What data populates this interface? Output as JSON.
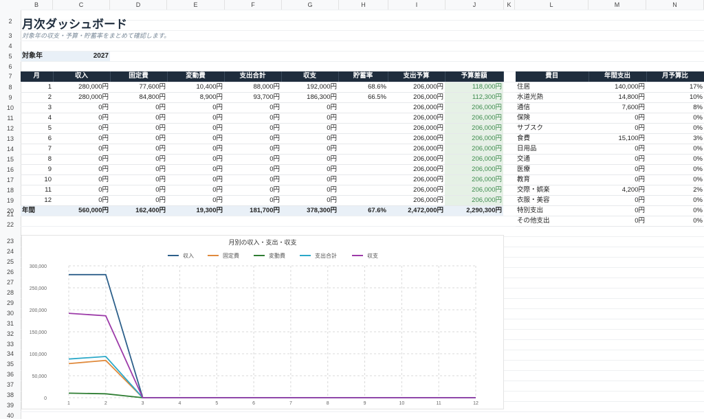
{
  "spreadsheet": {
    "columns": [
      "B",
      "C",
      "D",
      "E",
      "F",
      "G",
      "H",
      "I",
      "J",
      "K",
      "L",
      "M",
      "N"
    ],
    "rows": [
      "2",
      "3",
      "4",
      "5",
      "6",
      "7",
      "8",
      "9",
      "10",
      "11",
      "12",
      "13",
      "14",
      "15",
      "16",
      "17",
      "18",
      "19",
      "20",
      "21",
      "22",
      "23",
      "24",
      "25",
      "26",
      "27",
      "28",
      "29",
      "30",
      "31",
      "32",
      "33",
      "34",
      "35",
      "36",
      "37",
      "38",
      "39",
      "40"
    ]
  },
  "dashboard": {
    "title": "月次ダッシュボード",
    "subtitle": "対象年の収支・予算・貯蓄率をまとめて確認します。",
    "year_label": "対象年",
    "year_value": "2027"
  },
  "monthly_table": {
    "headers": [
      "月",
      "収入",
      "固定費",
      "変動費",
      "支出合計",
      "収支",
      "貯蓄率",
      "支出予算",
      "予算差額"
    ],
    "rows": [
      [
        "1",
        "280,000円",
        "77,600円",
        "10,400円",
        "88,000円",
        "192,000円",
        "68.6%",
        "206,000円",
        "118,000円"
      ],
      [
        "2",
        "280,000円",
        "84,800円",
        "8,900円",
        "93,700円",
        "186,300円",
        "66.5%",
        "206,000円",
        "112,300円"
      ],
      [
        "3",
        "0円",
        "0円",
        "0円",
        "0円",
        "0円",
        "",
        "206,000円",
        "206,000円"
      ],
      [
        "4",
        "0円",
        "0円",
        "0円",
        "0円",
        "0円",
        "",
        "206,000円",
        "206,000円"
      ],
      [
        "5",
        "0円",
        "0円",
        "0円",
        "0円",
        "0円",
        "",
        "206,000円",
        "206,000円"
      ],
      [
        "6",
        "0円",
        "0円",
        "0円",
        "0円",
        "0円",
        "",
        "206,000円",
        "206,000円"
      ],
      [
        "7",
        "0円",
        "0円",
        "0円",
        "0円",
        "0円",
        "",
        "206,000円",
        "206,000円"
      ],
      [
        "8",
        "0円",
        "0円",
        "0円",
        "0円",
        "0円",
        "",
        "206,000円",
        "206,000円"
      ],
      [
        "9",
        "0円",
        "0円",
        "0円",
        "0円",
        "0円",
        "",
        "206,000円",
        "206,000円"
      ],
      [
        "10",
        "0円",
        "0円",
        "0円",
        "0円",
        "0円",
        "",
        "206,000円",
        "206,000円"
      ],
      [
        "11",
        "0円",
        "0円",
        "0円",
        "0円",
        "0円",
        "",
        "206,000円",
        "206,000円"
      ],
      [
        "12",
        "0円",
        "0円",
        "0円",
        "0円",
        "0円",
        "",
        "206,000円",
        "206,000円"
      ]
    ],
    "total": [
      "年間",
      "560,000円",
      "162,400円",
      "19,300円",
      "181,700円",
      "378,300円",
      "67.6%",
      "2,472,000円",
      "2,290,300円"
    ]
  },
  "category_table": {
    "headers": [
      "費目",
      "年間支出",
      "月予算比"
    ],
    "rows": [
      [
        "住居",
        "140,000円",
        "17%"
      ],
      [
        "水道光熱",
        "14,800円",
        "10%"
      ],
      [
        "通信",
        "7,600円",
        "8%"
      ],
      [
        "保険",
        "0円",
        "0%"
      ],
      [
        "サブスク",
        "0円",
        "0%"
      ],
      [
        "食費",
        "15,100円",
        "3%"
      ],
      [
        "日用品",
        "0円",
        "0%"
      ],
      [
        "交通",
        "0円",
        "0%"
      ],
      [
        "医療",
        "0円",
        "0%"
      ],
      [
        "教育",
        "0円",
        "0%"
      ],
      [
        "交際・娯楽",
        "4,200円",
        "2%"
      ],
      [
        "衣服・美容",
        "0円",
        "0%"
      ],
      [
        "特別支出",
        "0円",
        "0%"
      ],
      [
        "その他支出",
        "0円",
        "0%"
      ]
    ]
  },
  "colors": {
    "header_bg": "#1f2d3d",
    "diff_bg": "#e6f1e6",
    "diff_text": "#3e8a4f",
    "total_bg": "#e9f0f7"
  },
  "chart_data": {
    "type": "line",
    "title": "月別の収入・支出・収支",
    "x": [
      1,
      2,
      3,
      4,
      5,
      6,
      7,
      8,
      9,
      10,
      11,
      12
    ],
    "ylim": [
      0,
      300000
    ],
    "yticks": [
      0,
      50000,
      100000,
      150000,
      200000,
      250000,
      300000
    ],
    "ytick_labels": [
      "0",
      "50,000",
      "100,000",
      "150,000",
      "200,000",
      "250,000",
      "300,000"
    ],
    "grid": true,
    "legend": "top-center",
    "series": [
      {
        "name": "収入",
        "color": "#2c5f8a",
        "values": [
          280000,
          280000,
          0,
          0,
          0,
          0,
          0,
          0,
          0,
          0,
          0,
          0
        ]
      },
      {
        "name": "固定費",
        "color": "#e08a3c",
        "values": [
          77600,
          84800,
          0,
          0,
          0,
          0,
          0,
          0,
          0,
          0,
          0,
          0
        ]
      },
      {
        "name": "変動費",
        "color": "#2e7d32",
        "values": [
          10400,
          8900,
          0,
          0,
          0,
          0,
          0,
          0,
          0,
          0,
          0,
          0
        ]
      },
      {
        "name": "支出合計",
        "color": "#2aa8c8",
        "values": [
          88000,
          93700,
          0,
          0,
          0,
          0,
          0,
          0,
          0,
          0,
          0,
          0
        ]
      },
      {
        "name": "収支",
        "color": "#9c3aa8",
        "values": [
          192000,
          186300,
          0,
          0,
          0,
          0,
          0,
          0,
          0,
          0,
          0,
          0
        ]
      }
    ]
  }
}
